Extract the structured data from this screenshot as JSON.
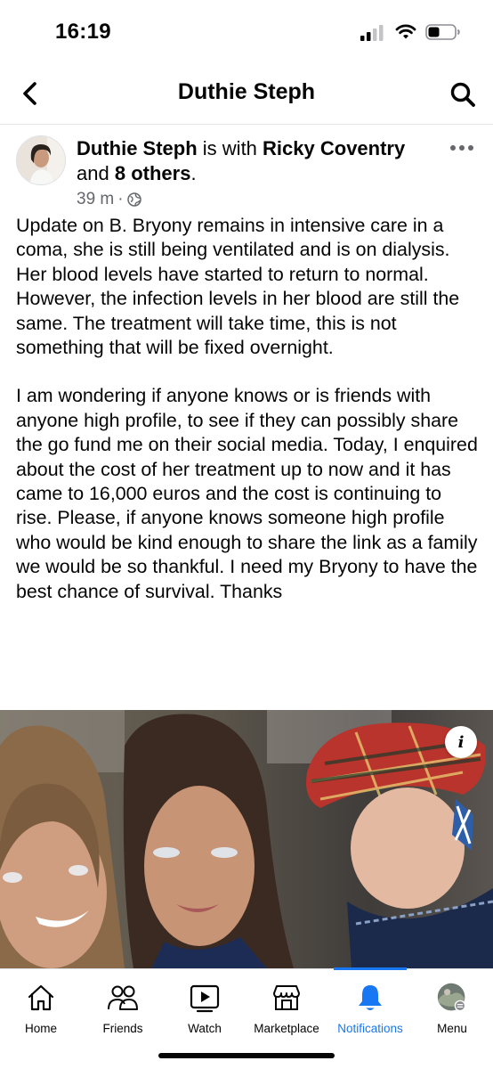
{
  "status_bar": {
    "time": "16:19"
  },
  "nav": {
    "title": "Duthie Steph"
  },
  "post": {
    "author": "Duthie Steph",
    "with_text": "is with",
    "tagged": "Ricky Coventry",
    "and_text": "and",
    "others": "8 others",
    "period": ".",
    "time": "39 m",
    "audience_sep": "·",
    "paragraphs": [
      "Update on B. Bryony remains in intensive care in a coma, she is still being ventilated and is on dialysis. Her blood levels have started to return to normal. However, the infection levels in her blood are still the same.  The treatment will take time, this is not something that will be fixed overnight.",
      "I am wondering if anyone knows or is friends with anyone high profile, to see if they can possibly share the go fund me on their social media. Today, I enquired about the cost of her treatment up to now and it has came to 16,000 euros and the cost is continuing to rise. Please, if anyone knows someone high profile who would be kind enough to share the link as a family we would be so thankful. I need my Bryony to have the best chance of survival. Thanks"
    ],
    "info_label": "i"
  },
  "tabs": [
    {
      "label": "Home",
      "icon": "home-icon"
    },
    {
      "label": "Friends",
      "icon": "friends-icon"
    },
    {
      "label": "Watch",
      "icon": "watch-icon"
    },
    {
      "label": "Marketplace",
      "icon": "marketplace-icon"
    },
    {
      "label": "Notifications",
      "icon": "bell-icon",
      "active": true
    },
    {
      "label": "Menu",
      "icon": "menu-avatar-icon"
    }
  ],
  "colors": {
    "accent": "#1877f2",
    "text": "#050505",
    "secondary": "#65676b"
  }
}
